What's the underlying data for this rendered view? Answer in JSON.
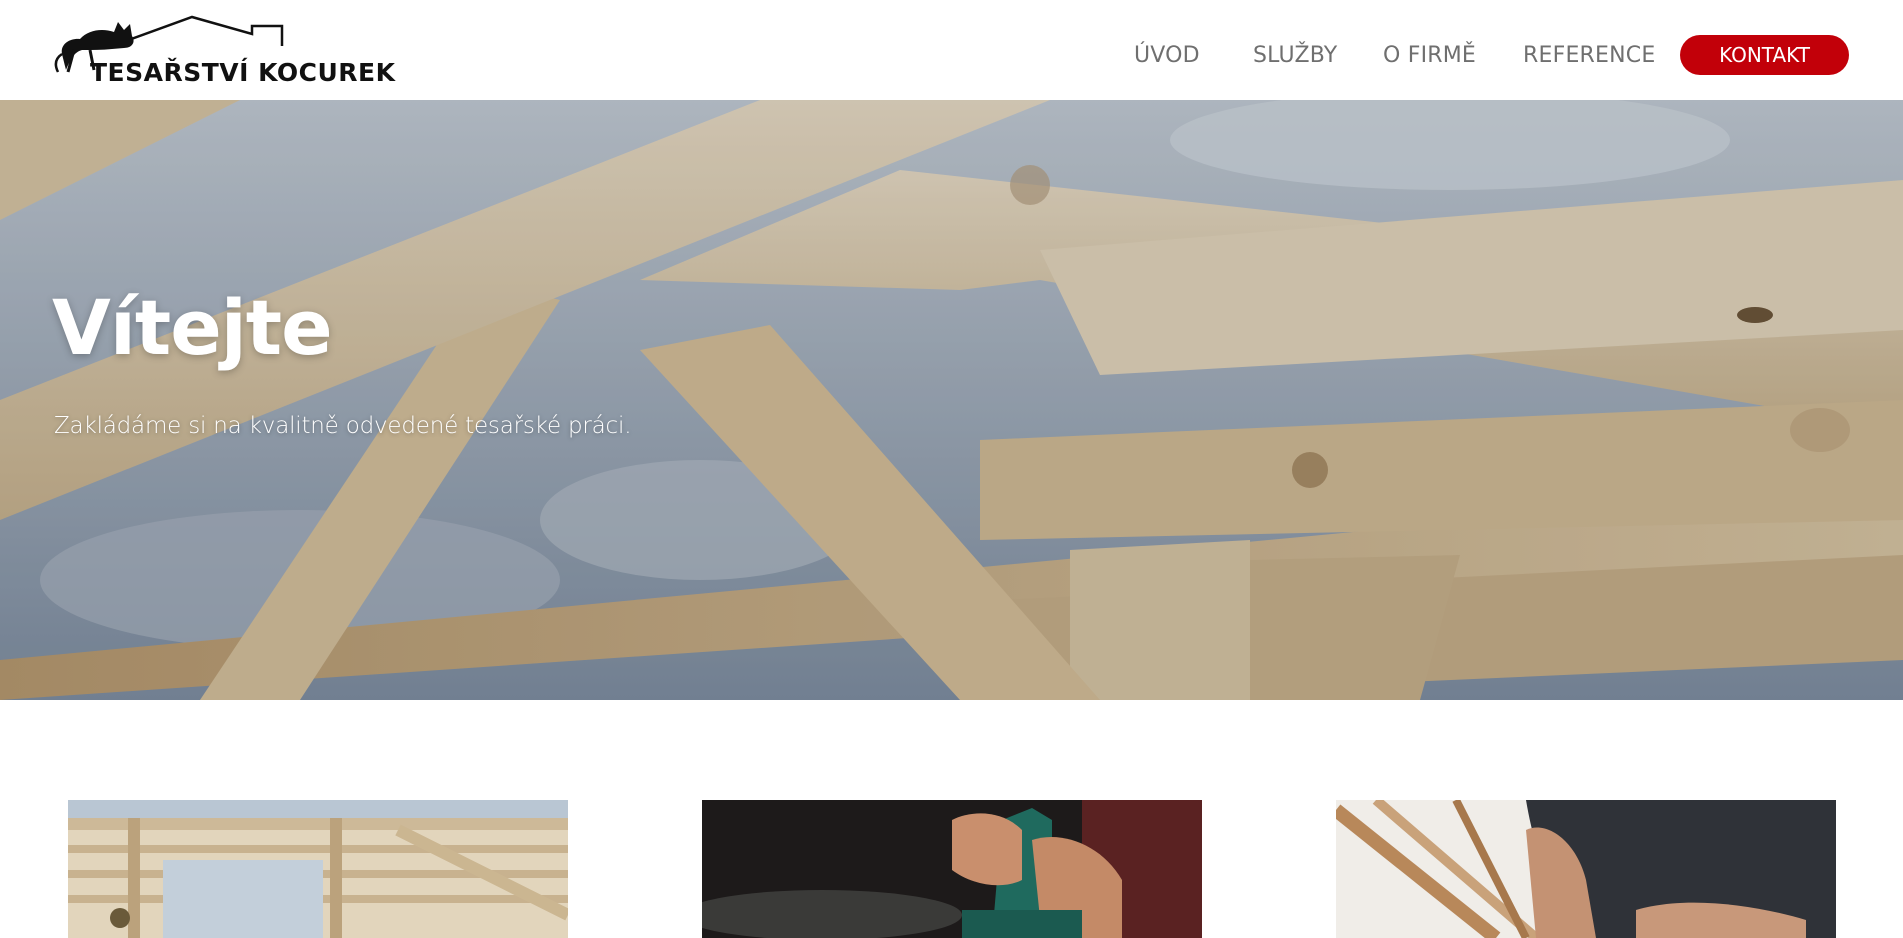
{
  "header": {
    "logo_text": "TESAŘSTVÍ KOCUREK",
    "logo_icon": "cat-on-roof-logo",
    "nav": [
      {
        "label": "ÚVOD"
      },
      {
        "label": "SLUŽBY"
      },
      {
        "label": "O FIRMĚ"
      },
      {
        "label": "REFERENCE"
      }
    ],
    "cta_label": "KONTAKT",
    "accent_color": "#c20009"
  },
  "hero": {
    "title": "Vítejte",
    "subtitle": "Zakládáme si na kvalitně odvedené tesařské práci."
  },
  "cards": [
    {
      "image": "timber-frame-construction-photo"
    },
    {
      "image": "electric-planer-on-wood-photo"
    },
    {
      "image": "carpenter-at-workbench-photo"
    }
  ]
}
